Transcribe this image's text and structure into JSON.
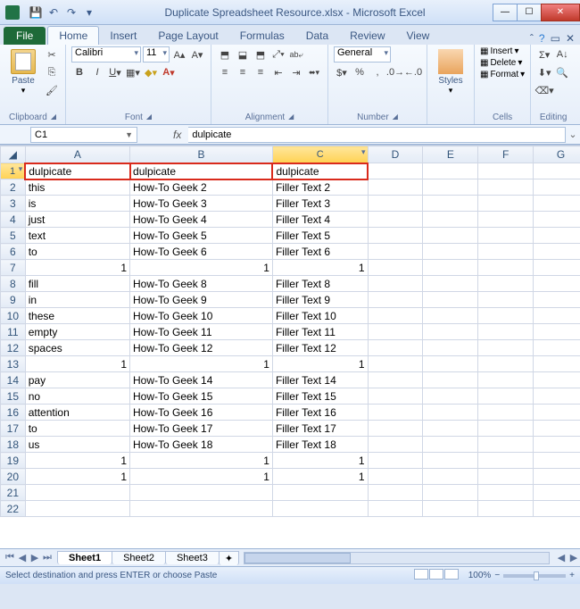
{
  "title": "Duplicate Spreadsheet Resource.xlsx  -  Microsoft Excel",
  "tabs": {
    "file": "File",
    "home": "Home",
    "insert": "Insert",
    "pagelayout": "Page Layout",
    "formulas": "Formulas",
    "data": "Data",
    "review": "Review",
    "view": "View"
  },
  "ribbon": {
    "clipboard": "Clipboard",
    "paste": "Paste",
    "font": "Font",
    "font_name": "Calibri",
    "font_size": "11",
    "alignment": "Alignment",
    "wrap": "Wrap Text",
    "merge": "Merge & Center",
    "number": "Number",
    "number_format": "General",
    "styles": "Styles",
    "cells": "Cells",
    "insert": "Insert",
    "delete": "Delete",
    "format": "Format",
    "editing": "Editing"
  },
  "namebox": "C1",
  "formula": "dulpicate",
  "columns": [
    "A",
    "B",
    "C",
    "D",
    "E",
    "F",
    "G"
  ],
  "rows": [
    {
      "n": "1",
      "a": "dulpicate",
      "b": "dulpicate",
      "c": "dulpicate"
    },
    {
      "n": "2",
      "a": "this",
      "b": "How-To Geek  2",
      "c": "Filler Text 2"
    },
    {
      "n": "3",
      "a": "is",
      "b": "How-To Geek  3",
      "c": "Filler Text 3"
    },
    {
      "n": "4",
      "a": "just",
      "b": "How-To Geek  4",
      "c": "Filler Text 4"
    },
    {
      "n": "5",
      "a": "text",
      "b": "How-To Geek  5",
      "c": "Filler Text 5"
    },
    {
      "n": "6",
      "a": "to",
      "b": "How-To Geek  6",
      "c": "Filler Text 6"
    },
    {
      "n": "7",
      "a": "1",
      "b": "1",
      "c": "1",
      "r": true
    },
    {
      "n": "8",
      "a": "fill",
      "b": "How-To Geek  8",
      "c": "Filler Text 8"
    },
    {
      "n": "9",
      "a": "in",
      "b": "How-To Geek  9",
      "c": "Filler Text 9"
    },
    {
      "n": "10",
      "a": "these",
      "b": "How-To Geek  10",
      "c": "Filler Text 10"
    },
    {
      "n": "11",
      "a": "empty",
      "b": "How-To Geek  11",
      "c": "Filler Text 11"
    },
    {
      "n": "12",
      "a": "spaces",
      "b": "How-To Geek  12",
      "c": "Filler Text 12"
    },
    {
      "n": "13",
      "a": "1",
      "b": "1",
      "c": "1",
      "r": true
    },
    {
      "n": "14",
      "a": "pay",
      "b": "How-To Geek  14",
      "c": "Filler Text 14"
    },
    {
      "n": "15",
      "a": "no",
      "b": "How-To Geek  15",
      "c": "Filler Text 15"
    },
    {
      "n": "16",
      "a": "attention",
      "b": "How-To Geek  16",
      "c": "Filler Text 16"
    },
    {
      "n": "17",
      "a": "to",
      "b": "How-To Geek  17",
      "c": "Filler Text 17"
    },
    {
      "n": "18",
      "a": "us",
      "b": "How-To Geek  18",
      "c": "Filler Text 18"
    },
    {
      "n": "19",
      "a": "1",
      "b": "1",
      "c": "1",
      "r": true
    },
    {
      "n": "20",
      "a": "1",
      "b": "1",
      "c": "1",
      "r": true
    },
    {
      "n": "21",
      "a": "",
      "b": "",
      "c": ""
    },
    {
      "n": "22",
      "a": "",
      "b": "",
      "c": ""
    }
  ],
  "sheets": {
    "s1": "Sheet1",
    "s2": "Sheet2",
    "s3": "Sheet3"
  },
  "status": "Select destination and press ENTER or choose Paste",
  "zoom": "100%"
}
